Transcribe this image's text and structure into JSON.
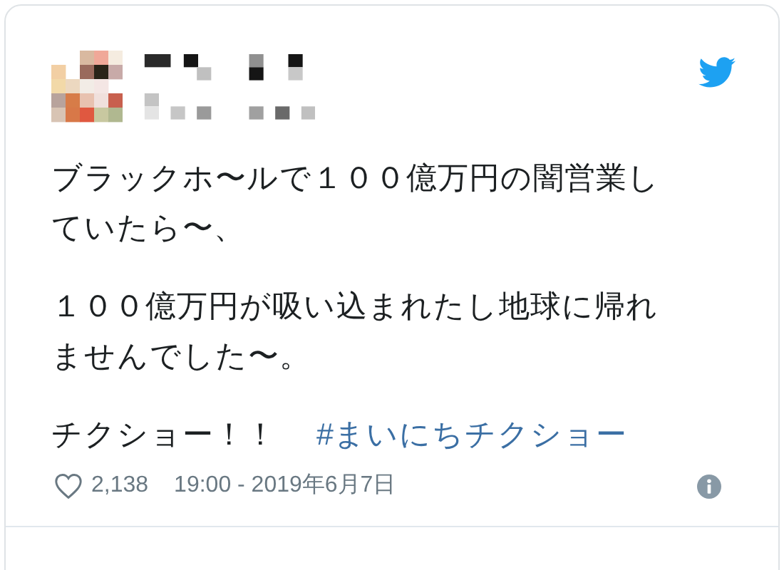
{
  "tweet": {
    "paragraphs": [
      "ブラックホ〜ルで１００億万円の闇営業していたら〜、",
      "１００億万円が吸い込まれたし地球に帰れませんでした〜。"
    ],
    "last_line": {
      "text": "チクショー！！",
      "hashtag": "#まいにちチクショー"
    },
    "likes": "2,138",
    "timestamp": "19:00 - 2019年6月7日"
  }
}
